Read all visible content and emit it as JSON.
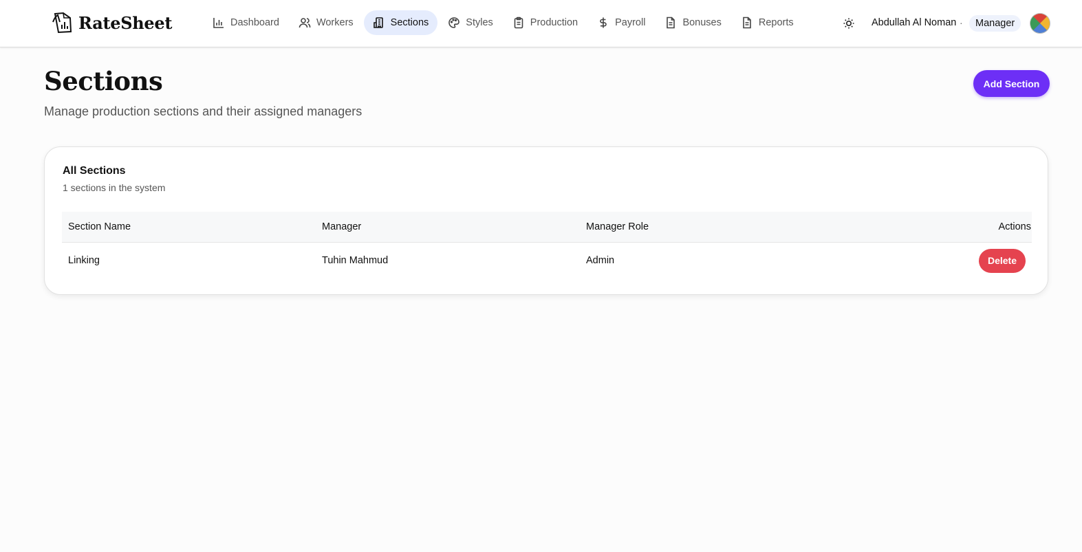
{
  "brand": {
    "name": "RateSheet"
  },
  "nav": {
    "items": [
      {
        "label": "Dashboard",
        "icon": "bar-chart-icon",
        "active": false
      },
      {
        "label": "Workers",
        "icon": "users-icon",
        "active": false
      },
      {
        "label": "Sections",
        "icon": "building-icon",
        "active": true
      },
      {
        "label": "Styles",
        "icon": "palette-icon",
        "active": false
      },
      {
        "label": "Production",
        "icon": "clipboard-icon",
        "active": false
      },
      {
        "label": "Payroll",
        "icon": "dollar-icon",
        "active": false
      },
      {
        "label": "Bonuses",
        "icon": "document-icon",
        "active": false
      },
      {
        "label": "Reports",
        "icon": "document-icon",
        "active": false
      }
    ]
  },
  "user": {
    "name": "Abdullah Al Noman",
    "separator": "·",
    "role": "Manager"
  },
  "page": {
    "title": "Sections",
    "subtitle": "Manage production sections and their assigned managers",
    "add_button": "Add Section"
  },
  "card": {
    "title": "All Sections",
    "description": "1 sections in the system"
  },
  "table": {
    "columns": [
      "Section Name",
      "Manager",
      "Manager Role",
      "Actions"
    ],
    "rows": [
      {
        "section": "Linking",
        "manager": "Tuhin Mahmud",
        "role": "Admin",
        "action": "Delete"
      }
    ]
  },
  "colors": {
    "accent": "#6d2ff6",
    "active_nav_bg": "#e5ecfd",
    "danger": "#e5434f"
  }
}
